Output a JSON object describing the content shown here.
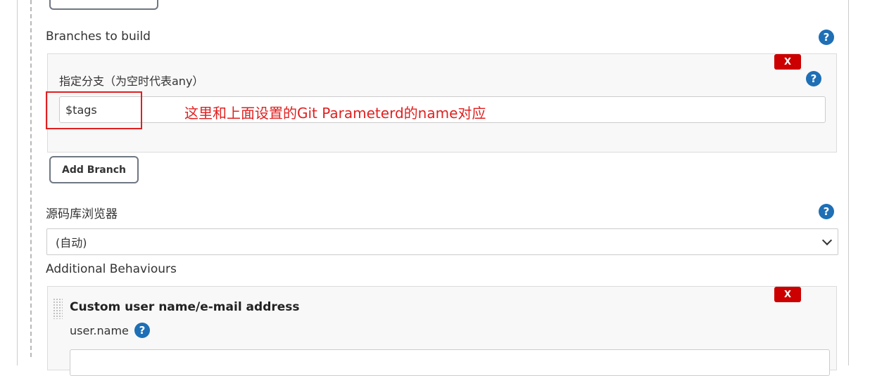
{
  "top_button": {
    "label": ""
  },
  "branches": {
    "title": "Branches to build",
    "branch_label": "指定分支（为空时代表any）",
    "branch_value": "$tags",
    "delete_label": "X",
    "add_button": "Add Branch",
    "help": "?"
  },
  "annotation": {
    "text": "这里和上面设置的Git Parameterd的name对应",
    "color": "#e02020"
  },
  "repo_browser": {
    "title": "源码库浏览器",
    "selected": "(自动)",
    "help": "?"
  },
  "behaviours": {
    "title": "Additional Behaviours",
    "item_title": "Custom user name/e-mail address",
    "field_label": "user.name",
    "delete_label": "X",
    "help": "?"
  },
  "colors": {
    "help_blue": "#1e6fb5",
    "delete_red": "#cc0000"
  }
}
